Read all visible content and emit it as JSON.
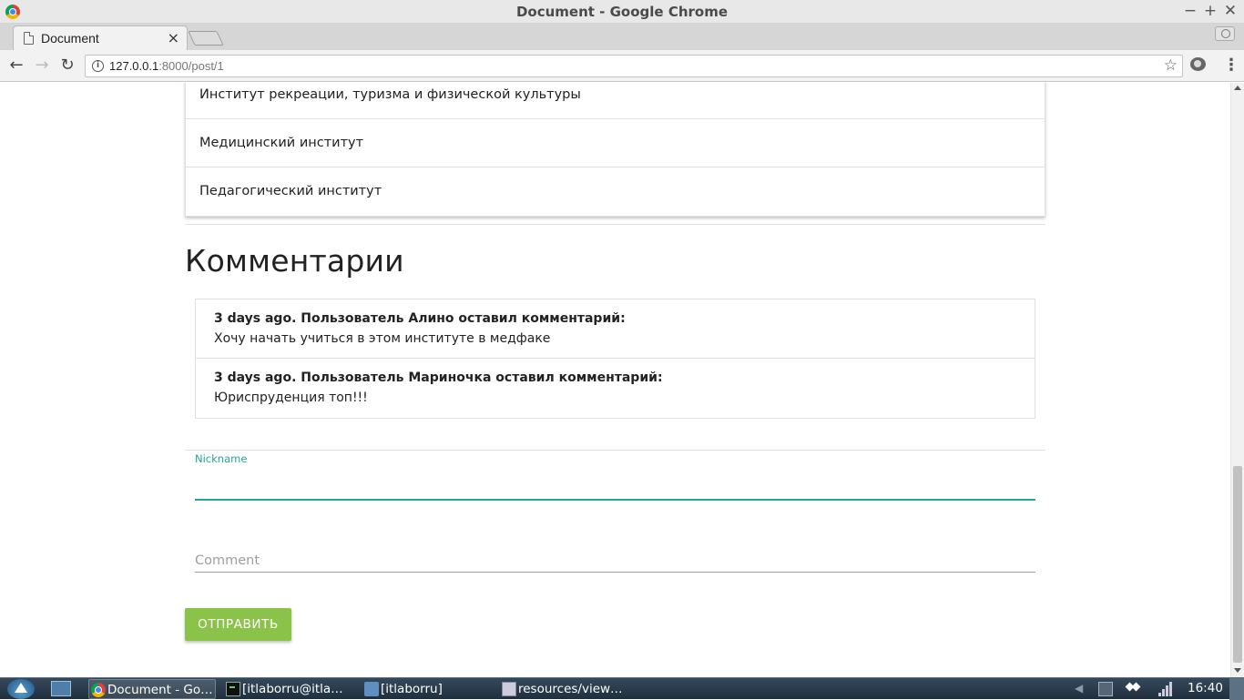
{
  "window": {
    "title": "Document - Google Chrome",
    "controls": {
      "minimize": "−",
      "maximize": "+",
      "close": "✕"
    }
  },
  "tab": {
    "label": "Document",
    "close": "×"
  },
  "toolbar": {
    "back": "←",
    "forward": "→",
    "reload": "↻",
    "url_host": "127.0.0.1",
    "url_rest": ":8000/post/1",
    "info": "i",
    "star": "☆",
    "menu": "⋮"
  },
  "page": {
    "institutes": [
      "Институт рекреации, туризма и физической культуры",
      "Медицинский институт",
      "Педагогический институт"
    ],
    "comments_heading": "Комментарии",
    "comments": [
      {
        "meta": "3 days ago. Пользователь Алино оставил комментарий:",
        "text": "Хочу начать учиться в этом институте в медфаке"
      },
      {
        "meta": "3 days ago. Пользователь Мариночка оставил комментарий:",
        "text": "Юриспруденция топ!!!"
      }
    ],
    "form": {
      "nickname_label": "Nickname",
      "nickname_value": "",
      "comment_label": "Comment",
      "comment_value": "",
      "submit_label": "ОТПРАВИТЬ"
    }
  },
  "taskbar": {
    "items": [
      {
        "label": "Document - Go…",
        "icon": "chrome-icon"
      },
      {
        "label": "[itlaborru@itla…",
        "icon": "terminal-icon"
      },
      {
        "label": "[itlaborru]",
        "icon": "folder-icon"
      },
      {
        "label": "resources/view…",
        "icon": "editor-icon"
      }
    ],
    "clock": "16:40"
  },
  "colors": {
    "accent_teal": "#26a69a",
    "button_green": "#8bc34a"
  }
}
